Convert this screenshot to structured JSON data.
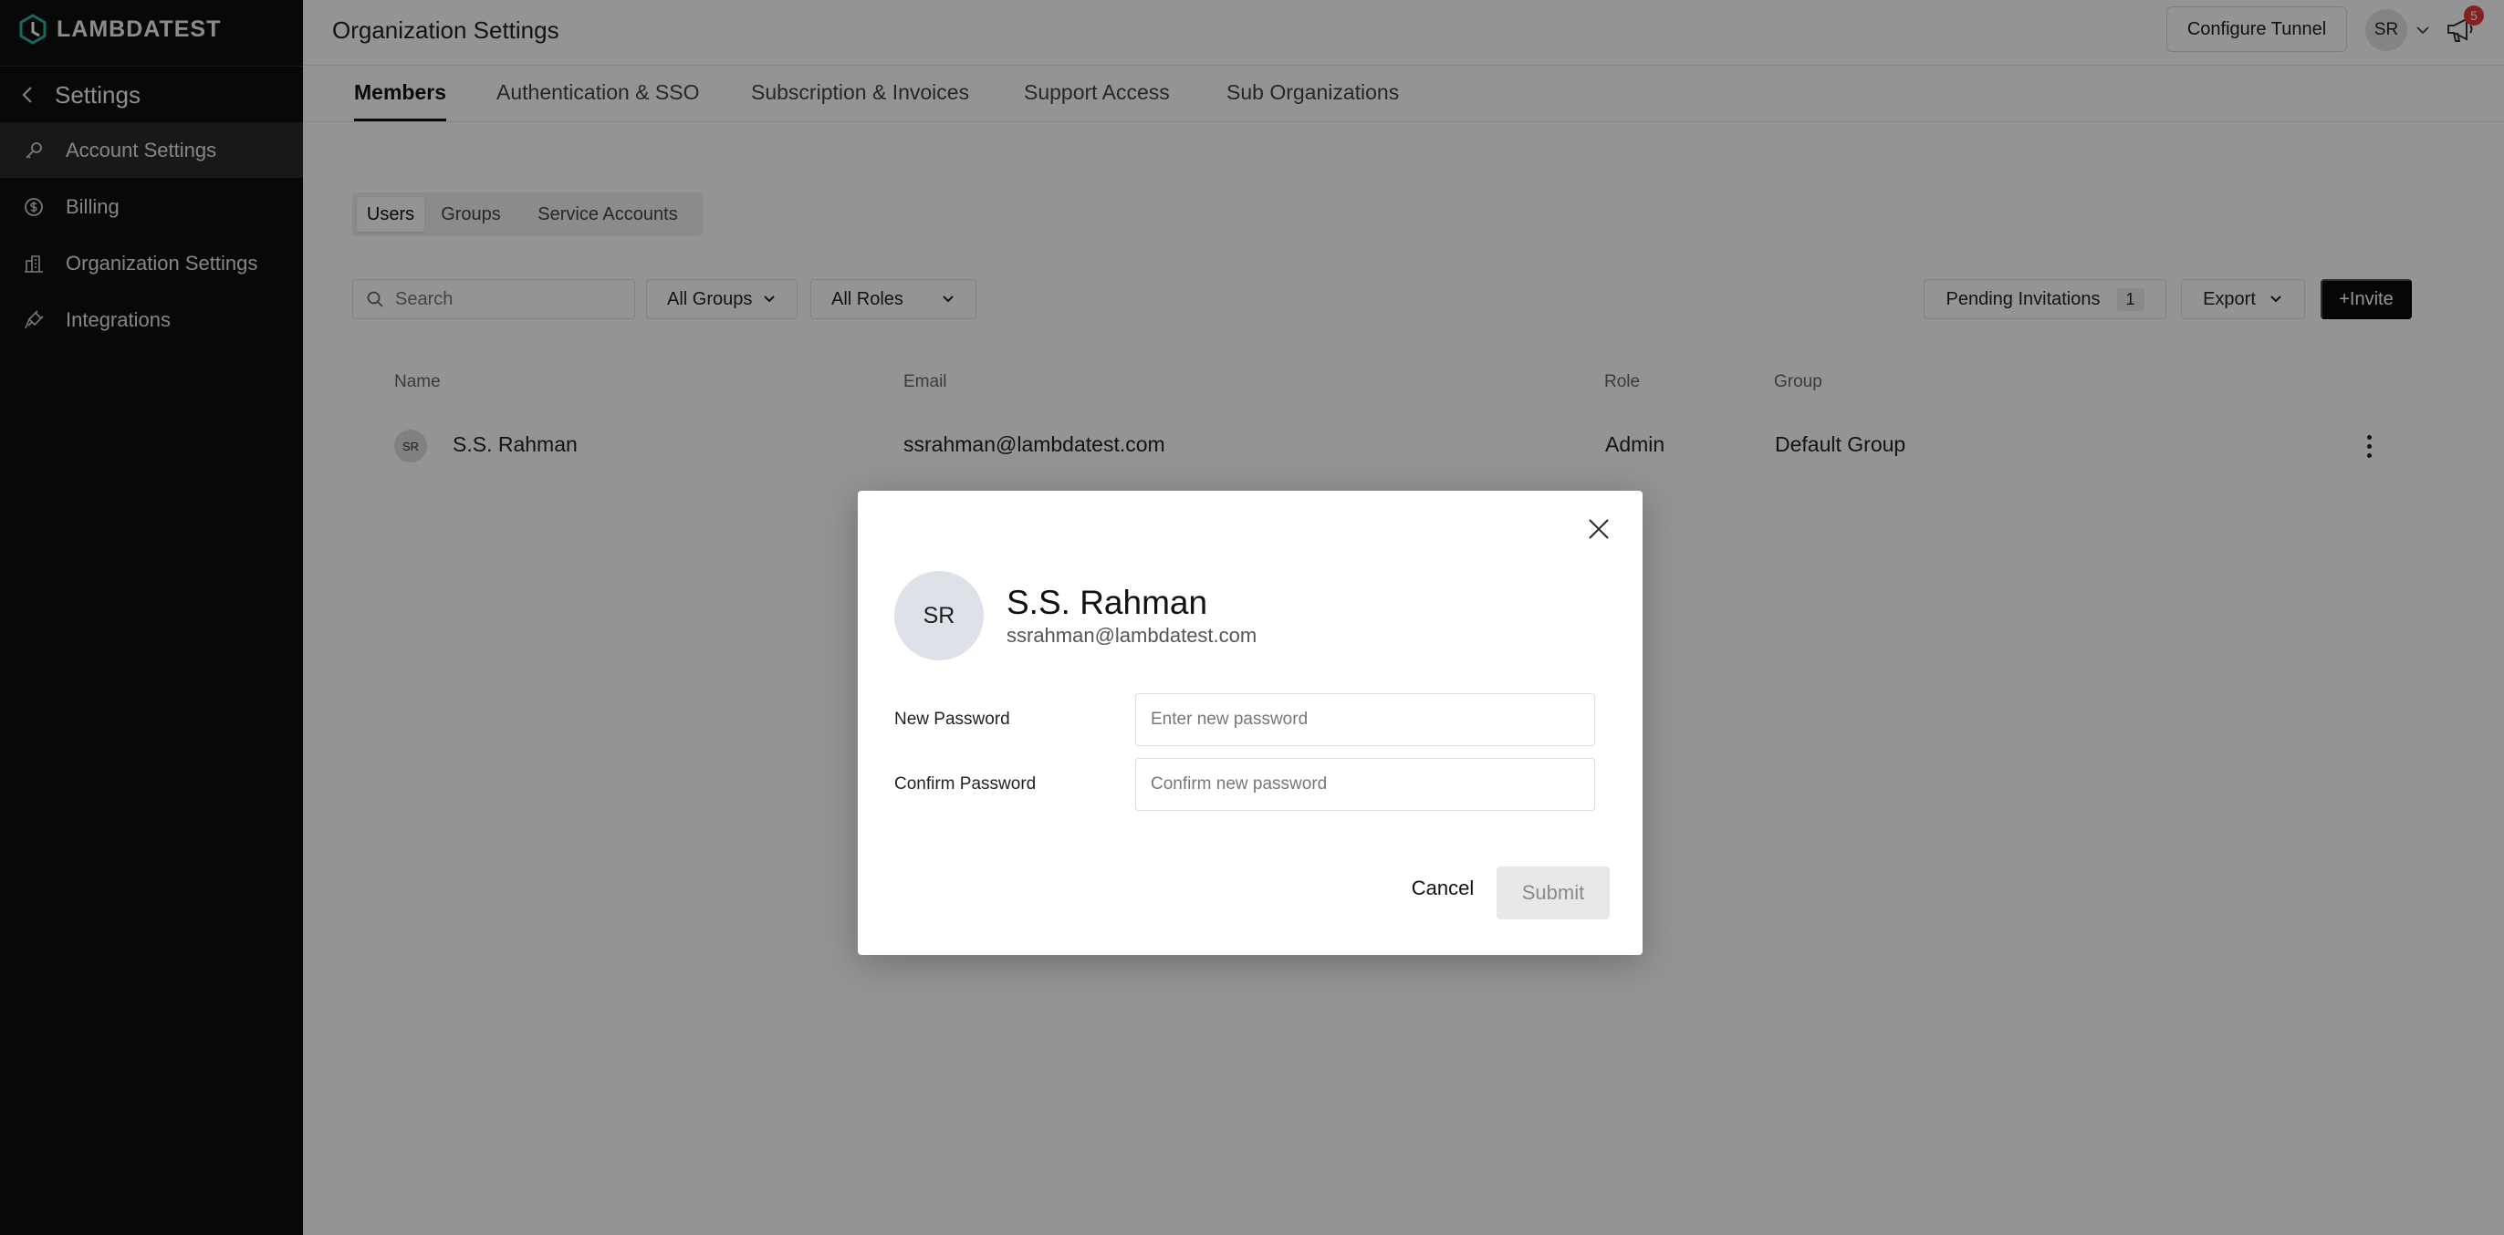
{
  "brand": {
    "name": "LAMBDATEST"
  },
  "sidebar": {
    "back_label": "Settings",
    "items": [
      {
        "label": "Account Settings",
        "icon": "key-icon",
        "active": true
      },
      {
        "label": "Billing",
        "icon": "dollar-icon",
        "active": false
      },
      {
        "label": "Organization Settings",
        "icon": "building-icon",
        "active": false
      },
      {
        "label": "Integrations",
        "icon": "plug-icon",
        "active": false
      }
    ]
  },
  "header": {
    "title": "Organization Settings",
    "configure_tunnel": "Configure Tunnel",
    "user_initials": "SR",
    "notification_count": "5"
  },
  "tabs": [
    {
      "label": "Members",
      "active": true
    },
    {
      "label": "Authentication & SSO",
      "active": false
    },
    {
      "label": "Subscription & Invoices",
      "active": false
    },
    {
      "label": "Support Access",
      "active": false
    },
    {
      "label": "Sub Organizations",
      "active": false
    }
  ],
  "subtabs": [
    {
      "label": "Users",
      "active": true
    },
    {
      "label": "Groups",
      "active": false
    },
    {
      "label": "Service Accounts",
      "active": false
    }
  ],
  "filters": {
    "search_placeholder": "Search",
    "groups": "All Groups",
    "roles": "All Roles",
    "pending_label": "Pending Invitations",
    "pending_count": "1",
    "export": "Export",
    "invite": "+Invite"
  },
  "table": {
    "columns": [
      "Name",
      "Email",
      "Role",
      "Group"
    ],
    "rows": [
      {
        "initials": "SR",
        "name": "S.S. Rahman",
        "email": "ssrahman@lambdatest.com",
        "role": "Admin",
        "group": "Default Group"
      }
    ]
  },
  "modal": {
    "initials": "SR",
    "name": "S.S. Rahman",
    "email": "ssrahman@lambdatest.com",
    "new_password_label": "New Password",
    "new_password_placeholder": "Enter new password",
    "confirm_password_label": "Confirm Password",
    "confirm_password_placeholder": "Confirm new password",
    "cancel": "Cancel",
    "submit": "Submit"
  },
  "colors": {
    "sidebar_bg": "#0f0f0f",
    "sidebar_active": "#2a2a2a",
    "brand_teal": "#2bb5a6",
    "invite_bg": "#0b0b0b",
    "badge": "#e53935"
  }
}
